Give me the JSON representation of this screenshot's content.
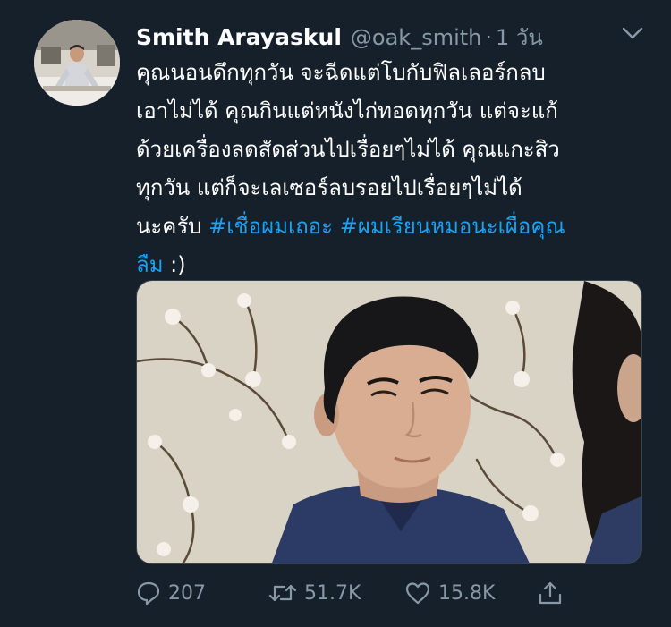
{
  "tweet": {
    "author_name": "Smith Arayaskul",
    "handle": "@oak_smith",
    "separator": "·",
    "time": "1 วัน",
    "text_lines": [
      "คุณนอนดึกทุกวัน จะฉีดแต่โบกับฟิลเลอร์กลบ",
      "เอาไม่ได้ คุณกินแต่หนังไก่ทอดทุกวัน แต่จะแก้",
      "ด้วยเครื่องลดสัดส่วนไปเรื่อยๆไม่ได้ คุณแกะสิว",
      "ทุกวัน แต่ก็จะเลเซอร์ลบรอยไปเรื่อยๆไม่ได้"
    ],
    "line5_prefix": "นะครับ ",
    "hashtag_1": "#เชื่อผมเถอะ",
    "hashtag_2": "#ผมเรียนหมอนะเผื่อคุณ",
    "hashtag_2_cont": "ลืม",
    "line6_suffix": " :)"
  },
  "actions": {
    "reply_count": "207",
    "retweet_count": "51.7K",
    "like_count": "15.8K"
  },
  "colors": {
    "background": "#15202b",
    "text": "#ffffff",
    "secondary": "#8899a6",
    "link": "#1da1f2"
  },
  "icons": [
    "chevron-down-icon",
    "reply-icon",
    "retweet-icon",
    "heart-icon",
    "share-icon"
  ]
}
